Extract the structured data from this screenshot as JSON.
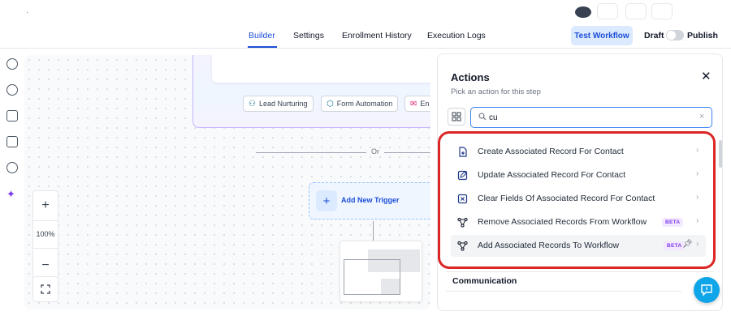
{
  "topbar": {
    "tabs": [
      {
        "label": "Builder",
        "active": true
      },
      {
        "label": "Settings",
        "active": false
      },
      {
        "label": "Enrollment History",
        "active": false
      },
      {
        "label": "Execution Logs",
        "active": false
      }
    ],
    "test_workflow_label": "Test Workflow",
    "draft_label": "Draft",
    "publish_label": "Publish",
    "publish_enabled": false
  },
  "canvas": {
    "chips": [
      {
        "label": "Lead Nurturing",
        "icon": "person-icon"
      },
      {
        "label": "Form Automation",
        "icon": "cube-icon"
      },
      {
        "label": "En",
        "icon": "mail-icon"
      }
    ],
    "or_label": "Or",
    "add_trigger_label": "Add New Trigger",
    "zoom_level": "100%"
  },
  "actions_panel": {
    "title": "Actions",
    "subtitle": "Pick an action for this step",
    "search": {
      "value": "cu",
      "placeholder": ""
    },
    "items": [
      {
        "label": "Create Associated Record For Contact",
        "icon": "create-record-icon",
        "beta": ""
      },
      {
        "label": "Update Associated Record For Contact",
        "icon": "edit-record-icon",
        "beta": ""
      },
      {
        "label": "Clear Fields Of Associated Record For Contact",
        "icon": "clear-fields-icon",
        "beta": ""
      },
      {
        "label": "Remove Associated Records From Workflow",
        "icon": "workflow-branch-icon",
        "beta": "BETA"
      },
      {
        "label": "Add Associated Records To Workflow",
        "icon": "workflow-branch-icon",
        "beta": "BETA"
      }
    ],
    "section_communication": "Communication"
  },
  "colors": {
    "accent": "#1d4ed8",
    "highlight_ring": "#dc2626",
    "beta": "#7c3aed",
    "help_fab": "#0ea5e9"
  }
}
